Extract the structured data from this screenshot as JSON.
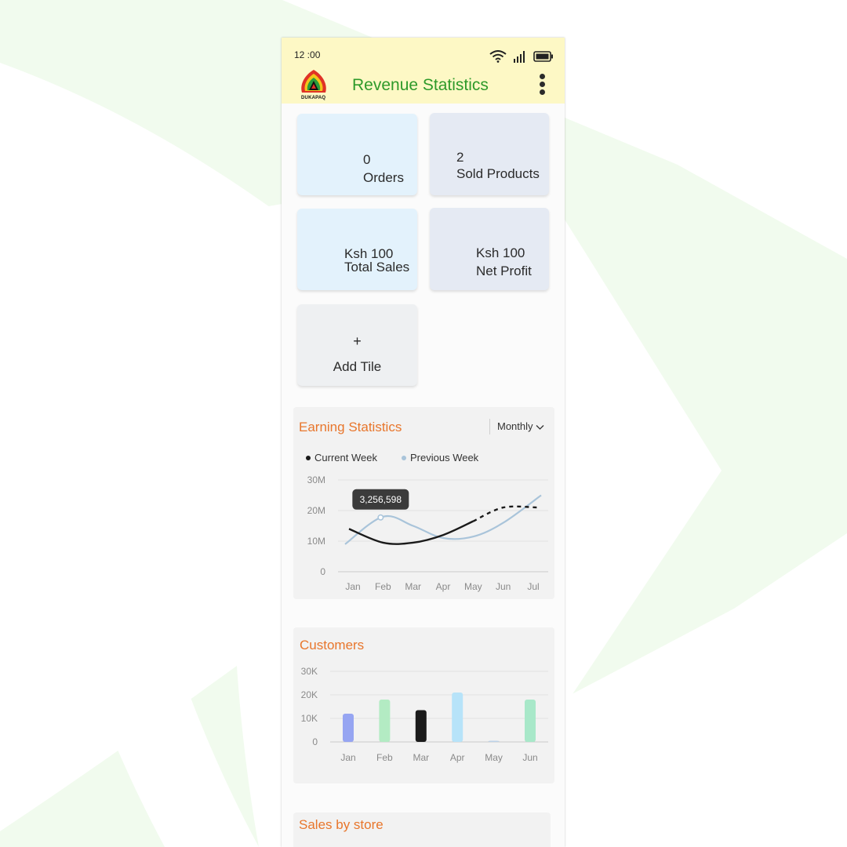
{
  "status_bar": {
    "time": "12 :00",
    "icons": [
      "wifi-icon",
      "signal-icon",
      "battery-icon"
    ]
  },
  "header": {
    "logo_text": "DUKAPAQ",
    "title": "Revenue Statistics",
    "menu_icon": "more-vertical-icon"
  },
  "tiles": {
    "orders": {
      "value": "0",
      "label": "Orders"
    },
    "sold": {
      "value": "2",
      "label": "Sold Products"
    },
    "sales": {
      "value": "Ksh 100",
      "label": "Total Sales"
    },
    "profit": {
      "value": "Ksh 100",
      "label": "Net Profit"
    },
    "add": {
      "icon": "+",
      "label": "Add Tile"
    }
  },
  "earning": {
    "title": "Earning Statistics",
    "period": "Monthly",
    "legend_current": "Current Week",
    "legend_previous": "Previous Week",
    "tooltip": "3,256,598"
  },
  "customers": {
    "title": "Customers"
  },
  "sales_by_store": {
    "title": "Sales by store"
  },
  "colors": {
    "header_bg": "#fdf8c5",
    "title_green": "#2e9a2a",
    "accent_orange": "#e8762c"
  },
  "chart_data": [
    {
      "type": "line",
      "x": [
        "Jan",
        "Feb",
        "Mar",
        "Apr",
        "May",
        "Jun",
        "Jul"
      ],
      "yticks": [
        "0",
        "10M",
        "20M",
        "30M"
      ],
      "ylim": [
        0,
        30
      ],
      "series": [
        {
          "name": "Current Week",
          "values": [
            14,
            9.5,
            9.5,
            12,
            16.5,
            21,
            21
          ],
          "color": "#1a1a1a",
          "dashed_from_index": 4
        },
        {
          "name": "Previous Week",
          "values": [
            9,
            18,
            15,
            11,
            11.5,
            16,
            25
          ],
          "color": "#a9c4da"
        }
      ],
      "tooltip_value": "3,256,598",
      "grid": true
    },
    {
      "type": "bar",
      "categories": [
        "Jan",
        "Feb",
        "Mar",
        "Apr",
        "May",
        "Jun"
      ],
      "values": [
        12000,
        18000,
        13500,
        21000,
        200,
        18000
      ],
      "colors": [
        "#96a5f2",
        "#b3ebc3",
        "#1b1b1b",
        "#b7e3f9",
        "#bdd3e8",
        "#a8e8c9"
      ],
      "yticks": [
        "0",
        "10K",
        "20K",
        "30K"
      ],
      "ylim": [
        0,
        30000
      ],
      "grid": true
    }
  ]
}
